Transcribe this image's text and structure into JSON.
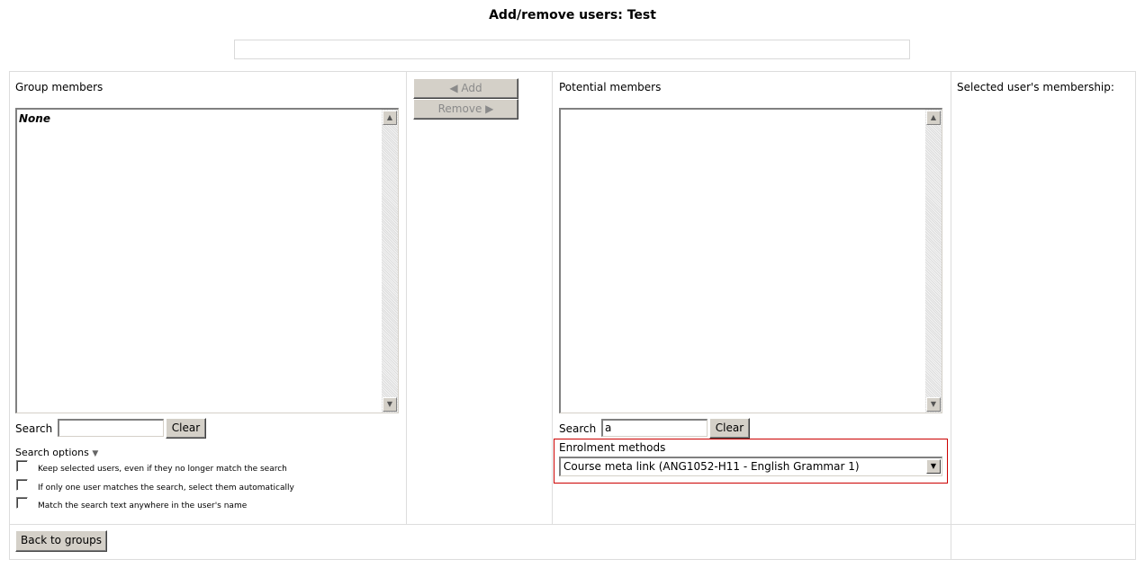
{
  "page": {
    "title": "Add/remove users: Test"
  },
  "group_members": {
    "label": "Group members",
    "options": [
      "None"
    ],
    "search_label": "Search",
    "search_value": "",
    "clear_label": "Clear",
    "search_options_label": "Search options",
    "options_list": [
      {
        "label": "Keep selected users, even if they no longer match the search",
        "checked": false
      },
      {
        "label": "If only one user matches the search, select them automatically",
        "checked": false
      },
      {
        "label": "Match the search text anywhere in the user's name",
        "checked": false
      }
    ]
  },
  "actions": {
    "add_label": "◀ Add",
    "remove_label": "Remove ▶"
  },
  "potential_members": {
    "label": "Potential members",
    "search_label": "Search",
    "search_value": "a",
    "clear_label": "Clear",
    "enrolment_label": "Enrolment methods",
    "enrolment_selected": "Course meta link (ANG1052-H11 - English Grammar 1)"
  },
  "membership": {
    "label": "Selected user's membership:"
  },
  "footer": {
    "back_label": "Back to groups"
  },
  "colors": {
    "highlight_border": "#cc0000",
    "button_face": "#d4d0c8"
  }
}
